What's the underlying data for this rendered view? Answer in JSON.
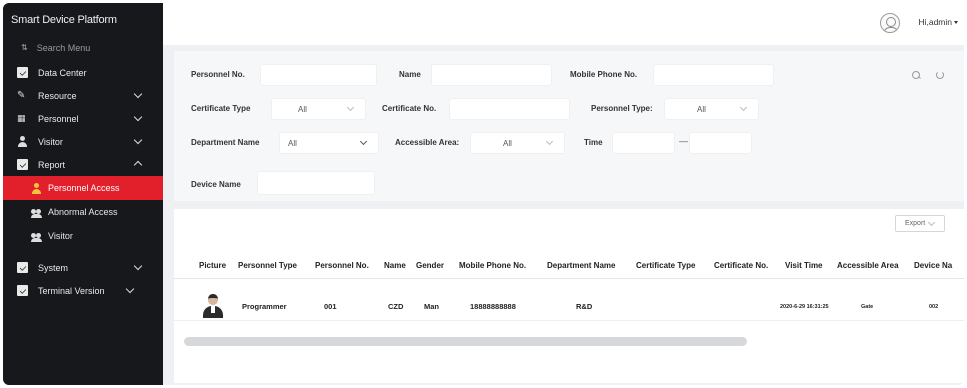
{
  "app": {
    "title": "Smart Device Platform"
  },
  "user": {
    "greeting": "Hi,admin"
  },
  "sidebar": {
    "search_label": "Search Menu",
    "items": [
      {
        "label": "Data Center"
      },
      {
        "label": "Resource"
      },
      {
        "label": "Personnel"
      },
      {
        "label": "Visitor"
      },
      {
        "label": "Report"
      }
    ],
    "report_sub": [
      {
        "label": "Personnel Access"
      },
      {
        "label": "Abnormal Access"
      },
      {
        "label": "Visitor"
      }
    ],
    "bottom_items": [
      {
        "label": "System"
      },
      {
        "label": "Terminal Version"
      }
    ]
  },
  "filters": {
    "personnel_no": {
      "label": "Personnel No.",
      "value": ""
    },
    "name": {
      "label": "Name",
      "value": ""
    },
    "mobile": {
      "label": "Mobile Phone No.",
      "value": ""
    },
    "certificate_type": {
      "label": "Certificate Type",
      "value": "All"
    },
    "certificate_no": {
      "label": "Certificate No.",
      "value": ""
    },
    "personnel_type": {
      "label": "Personnel Type:",
      "value": "All"
    },
    "department": {
      "label": "Department Name",
      "value": "All"
    },
    "accessible_area": {
      "label": "Accessible Area:",
      "value": "All"
    },
    "time": {
      "label": "Time",
      "separator": "—"
    },
    "device_name": {
      "label": "Device Name",
      "value": ""
    }
  },
  "results": {
    "export_label": "Export",
    "columns": [
      "Picture",
      "Personnel Type",
      "Personnel No.",
      "Name",
      "Gender",
      "Mobile Phone No.",
      "Department Name",
      "Certificate Type",
      "Certificate No.",
      "Visit Time",
      "Accessible Area",
      "Device Na"
    ],
    "rows": [
      {
        "personnel_type": "Programmer",
        "personnel_no": "001",
        "name": "CZD",
        "gender": "Man",
        "mobile": "18888888888",
        "department": "R&D",
        "certificate_type": "",
        "certificate_no": "",
        "visit_time": "2020-6-29 16:31:25",
        "accessible_area": "Gate",
        "device": "002"
      }
    ]
  },
  "colors": {
    "sidebar_bg": "#17181c",
    "active": "#e2202c",
    "page_bg": "#eef0f3"
  }
}
